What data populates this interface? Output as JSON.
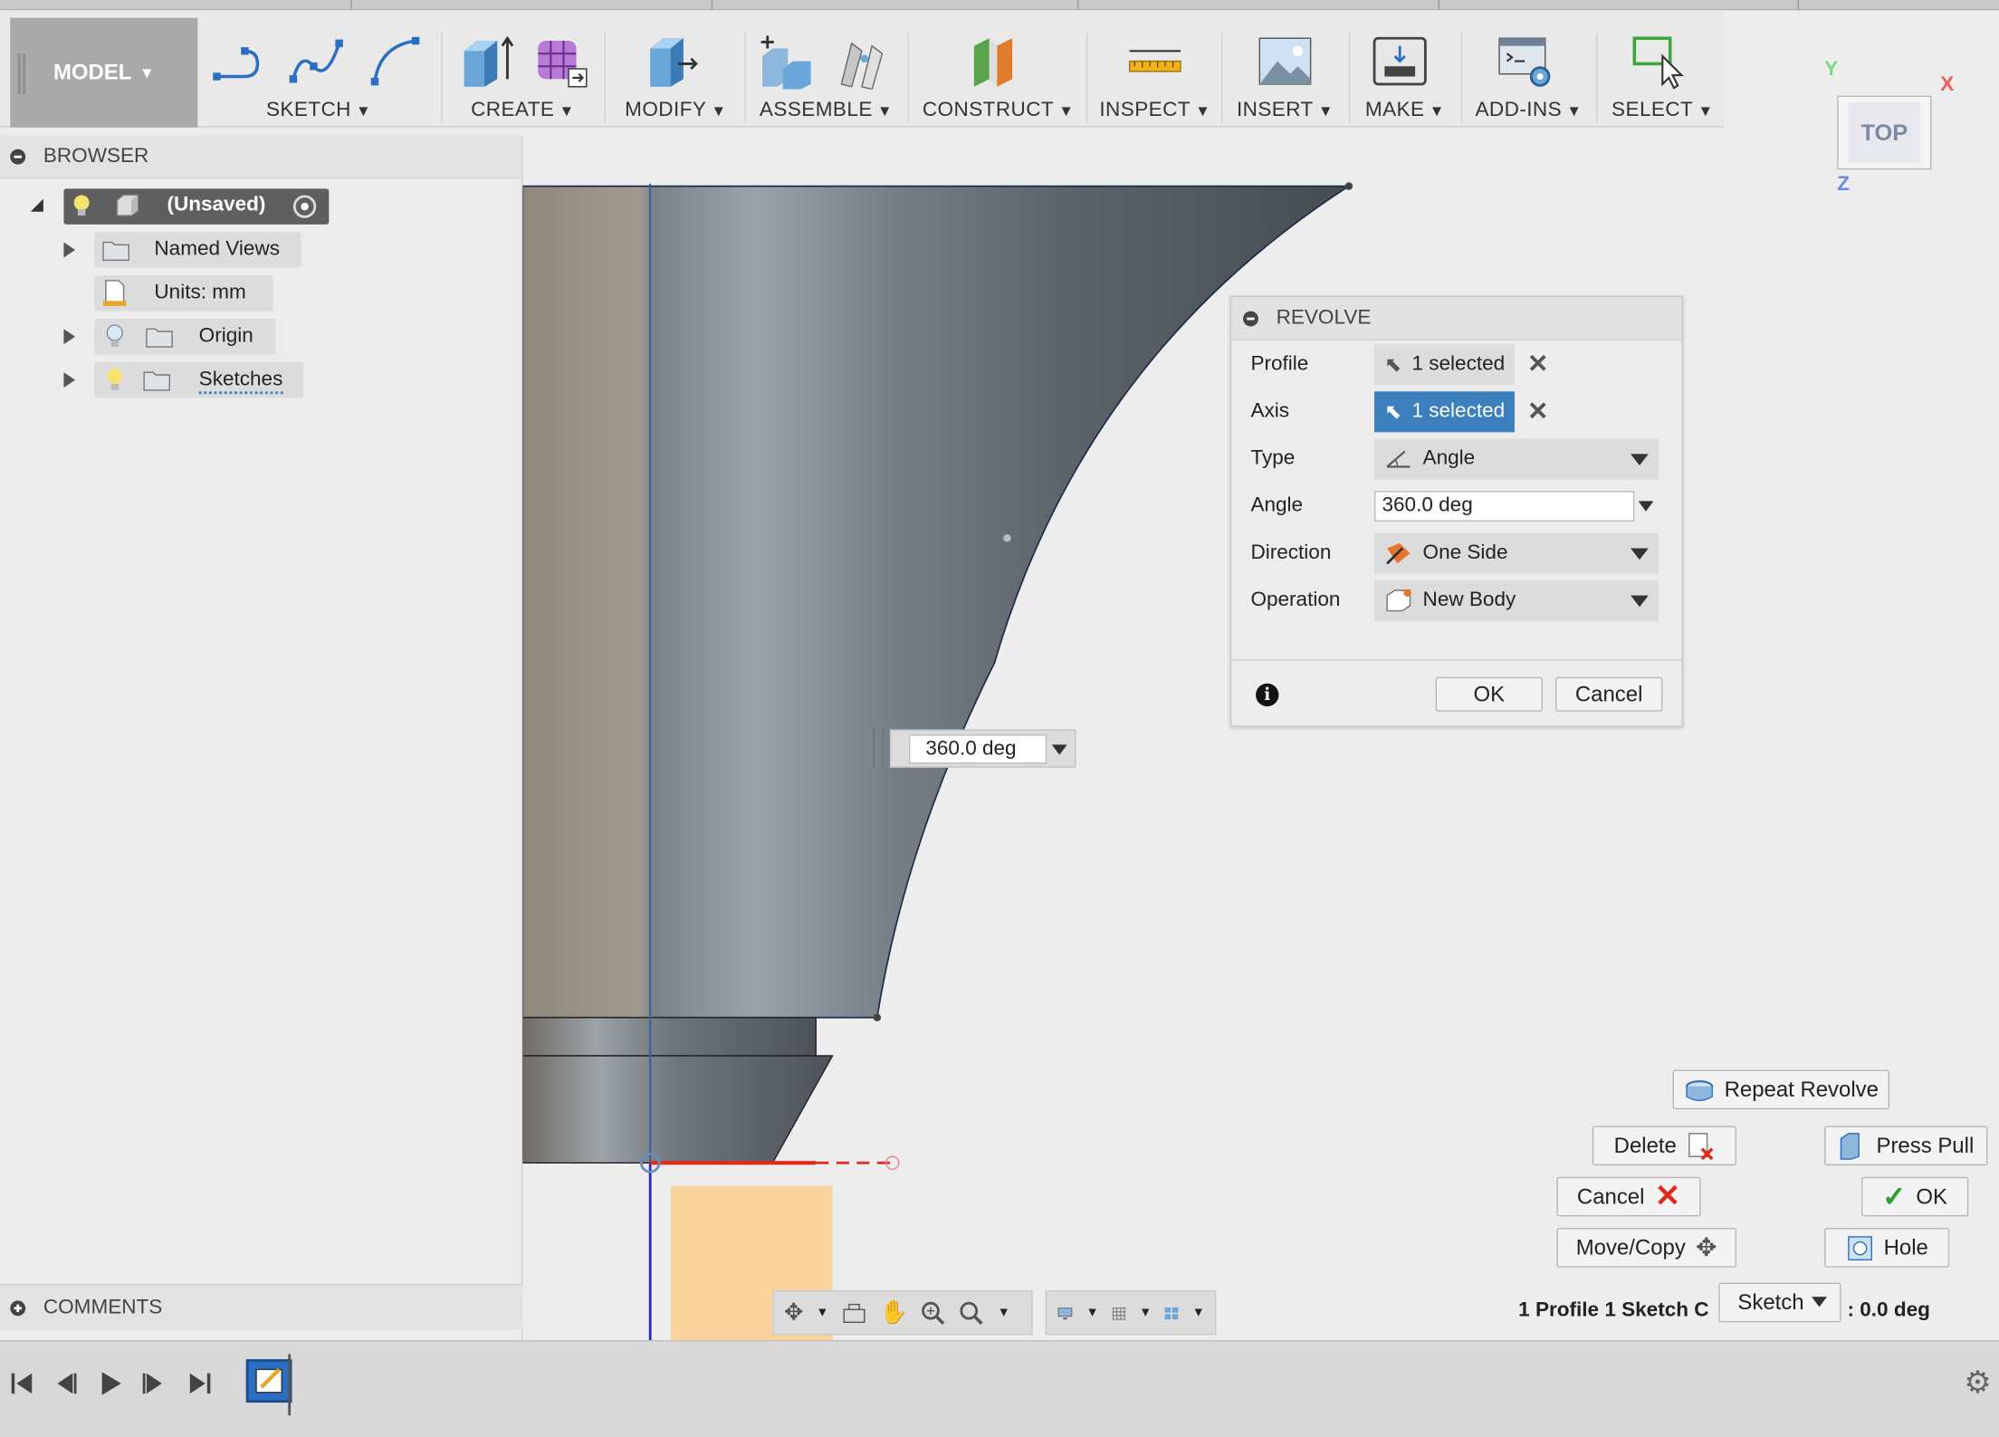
{
  "toolbar": {
    "model_label": "MODEL",
    "groups": {
      "sketch": "SKETCH",
      "create": "CREATE",
      "modify": "MODIFY",
      "assemble": "ASSEMBLE",
      "construct": "CONSTRUCT",
      "inspect": "INSPECT",
      "insert": "INSERT",
      "make": "MAKE",
      "addins": "ADD-INS",
      "select": "SELECT"
    }
  },
  "browser": {
    "title": "BROWSER",
    "root": "(Unsaved)",
    "items": [
      {
        "label": "Named Views"
      },
      {
        "label": "Units: mm"
      },
      {
        "label": "Origin"
      },
      {
        "label": "Sketches"
      }
    ]
  },
  "comments": {
    "title": "COMMENTS"
  },
  "canvas": {
    "angle_input": "360.0 deg"
  },
  "revolve": {
    "title": "REVOLVE",
    "profile_label": "Profile",
    "profile_value": "1 selected",
    "axis_label": "Axis",
    "axis_value": "1 selected",
    "type_label": "Type",
    "type_value": "Angle",
    "angle_label": "Angle",
    "angle_value": "360.0 deg",
    "direction_label": "Direction",
    "direction_value": "One Side",
    "operation_label": "Operation",
    "operation_value": "New Body",
    "ok": "OK",
    "cancel": "Cancel"
  },
  "marking_menu": {
    "repeat": "Repeat Revolve",
    "delete": "Delete",
    "press_pull": "Press Pull",
    "cancel": "Cancel",
    "ok": "OK",
    "move_copy": "Move/Copy",
    "hole": "Hole",
    "sketch_dropdown": "Sketch"
  },
  "status": {
    "left": "1 Profile 1 Sketch C",
    "right": ": 0.0 deg"
  },
  "viewcube": {
    "face": "TOP",
    "x": "X",
    "y": "Y",
    "z": "Z"
  },
  "colors": {
    "accent": "#3b7fbd",
    "profile_fill": "#f8d39e",
    "axis_red": "#e02a1b"
  }
}
